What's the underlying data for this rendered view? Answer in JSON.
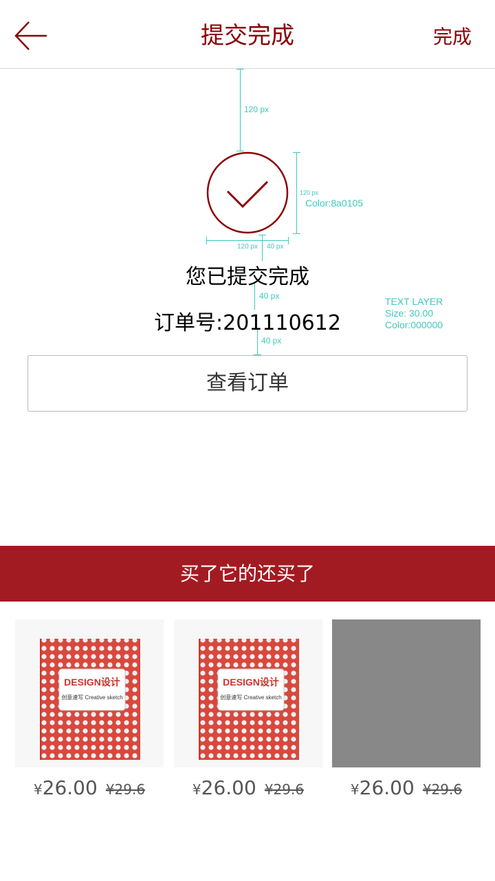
{
  "header": {
    "title": "提交完成",
    "done_label": "完成",
    "back_icon": "arrow-left-icon"
  },
  "success": {
    "icon": "check-circle-icon",
    "message": "您已提交完成",
    "order_number": "订单号:201110612"
  },
  "annotations": {
    "top_gap": "120 px",
    "circle_height": "120 px",
    "circle_color": "Color:8a0105",
    "circle_width": "120 px",
    "circle_to_text": "40 px",
    "text_gap": "40 px",
    "order_to_button": "40 px",
    "text_layer": "TEXT LAYER",
    "text_size": "Size: 30.00",
    "text_color": "Color:000000"
  },
  "view_order_label": "查看订单",
  "recommend_banner": "买了它的还买了",
  "products": [
    {
      "yen": "¥",
      "price": "26.00",
      "original": "¥29.6",
      "image": "book-cover",
      "cover_title": "DESIGN设计",
      "cover_subtitle": "创意速写 Creative sketch"
    },
    {
      "yen": "¥",
      "price": "26.00",
      "original": "¥29.6",
      "image": "book-cover",
      "cover_title": "DESIGN设计",
      "cover_subtitle": "创意速写 Creative sketch"
    },
    {
      "yen": "¥",
      "price": "26.00",
      "original": "¥29.6",
      "image": "placeholder-gray"
    }
  ],
  "colors": {
    "accent": "#8a0105",
    "banner": "#a31b22",
    "annotation": "#3cc9c0",
    "placeholder": "#888888"
  }
}
